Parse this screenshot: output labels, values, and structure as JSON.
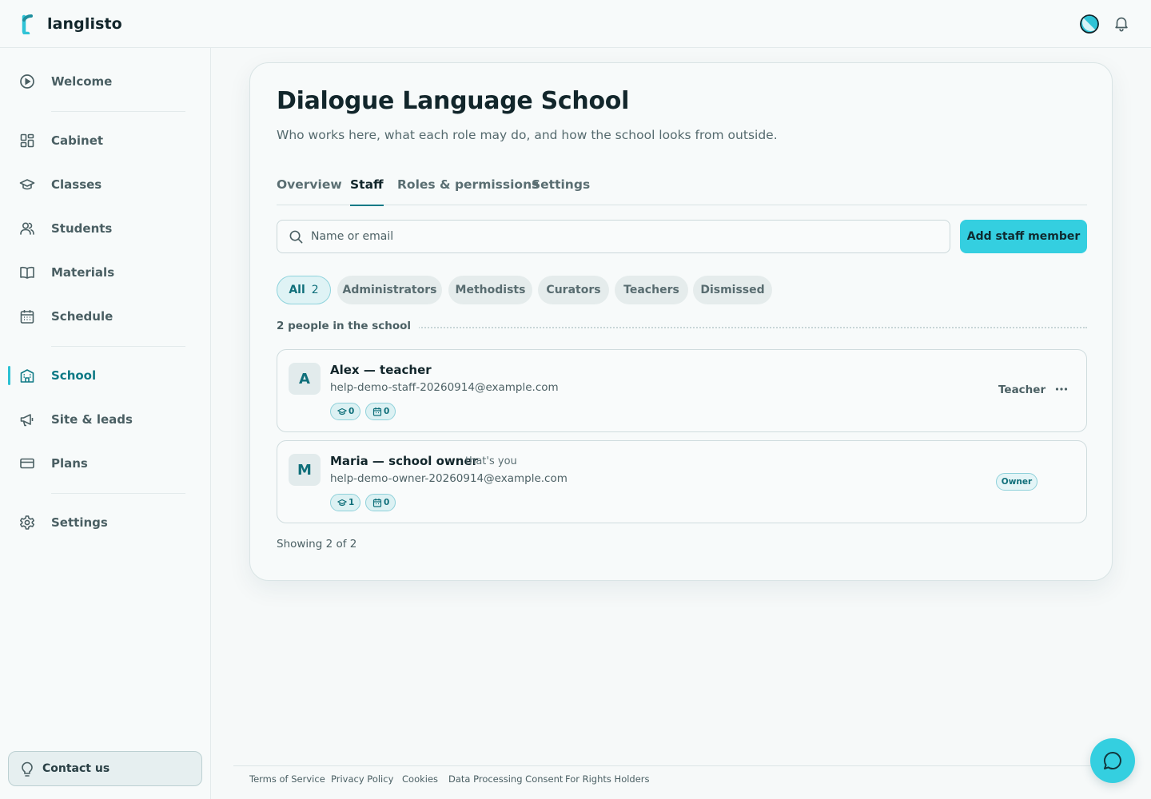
{
  "app": {
    "name": "langlisto",
    "icons": {
      "logo": "langlisto-logo-icon",
      "theme": "theme-toggle-icon",
      "notifications": "bell-icon"
    }
  },
  "sidebar": {
    "items": [
      {
        "label": "Welcome",
        "icon": "play-circle-icon",
        "active": false
      },
      {
        "label": "Cabinet",
        "icon": "dashboard-icon",
        "active": false
      },
      {
        "label": "Classes",
        "icon": "graduation-cap-icon",
        "active": false
      },
      {
        "label": "Students",
        "icon": "users-icon",
        "active": false
      },
      {
        "label": "Materials",
        "icon": "book-icon",
        "active": false
      },
      {
        "label": "Schedule",
        "icon": "calendar-icon",
        "active": false
      },
      {
        "label": "School",
        "icon": "school-building-icon",
        "active": true
      },
      {
        "label": "Site & leads",
        "icon": "megaphone-icon",
        "active": false
      },
      {
        "label": "Plans",
        "icon": "credit-card-icon",
        "active": false
      },
      {
        "label": "Settings",
        "icon": "gear-icon",
        "active": false
      }
    ],
    "contact_label": "Contact us"
  },
  "school": {
    "title": "Dialogue Language School",
    "subtitle": "Who works here, what each role may do, and how the school looks from outside."
  },
  "tabs": [
    {
      "label": "Overview",
      "active": false
    },
    {
      "label": "Staff",
      "active": true
    },
    {
      "label": "Roles & permissions",
      "active": false
    },
    {
      "label": "Settings",
      "active": false
    }
  ],
  "search": {
    "placeholder": "Name or email",
    "value": ""
  },
  "add_button_label": "Add staff member",
  "filters": [
    {
      "label": "All",
      "count": "2",
      "active": true
    },
    {
      "label": "Administrators",
      "active": false
    },
    {
      "label": "Methodists",
      "active": false
    },
    {
      "label": "Curators",
      "active": false
    },
    {
      "label": "Teachers",
      "active": false
    },
    {
      "label": "Dismissed",
      "active": false
    }
  ],
  "people_count_label": "2 people in the school",
  "staff": [
    {
      "initial": "A",
      "name": "Alex — teacher",
      "note": "",
      "email": "help-demo-staff-20260914@example.com",
      "classes_count": "0",
      "lessons_count": "0",
      "role": "Teacher"
    },
    {
      "initial": "M",
      "name": "Maria — school owner",
      "note": "that's you",
      "email": "help-demo-owner-20260914@example.com",
      "classes_count": "1",
      "lessons_count": "0",
      "role": "Owner"
    }
  ],
  "showing_label": "Showing 2 of 2",
  "footer": {
    "links": [
      "Terms of Service",
      "Privacy Policy",
      "Cookies",
      "Data Processing Consent",
      "For Rights Holders"
    ]
  },
  "colors": {
    "accent": "#34cfe0",
    "accent_dark": "#0f7a86",
    "text": "#12262b"
  }
}
